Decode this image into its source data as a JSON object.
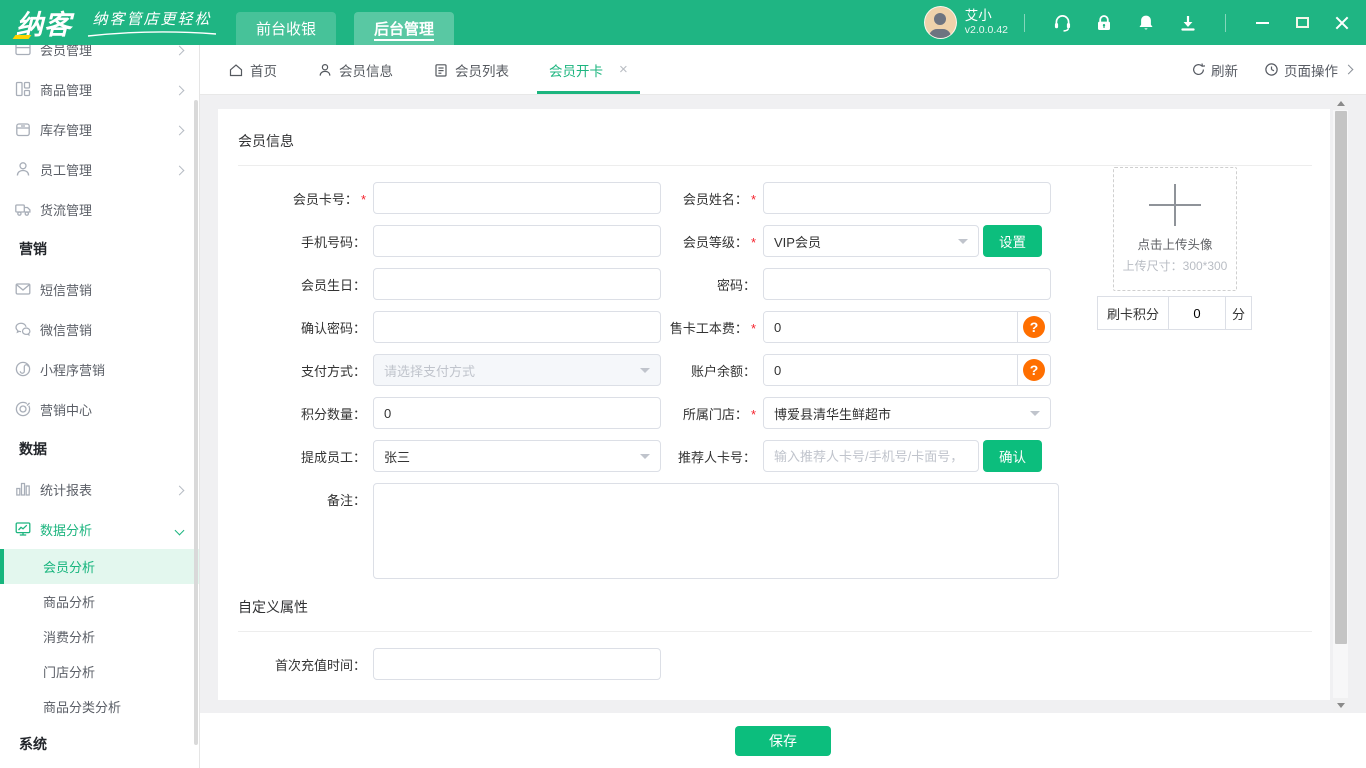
{
  "topbar": {
    "logo": "纳客",
    "tagline": "纳客管店更轻松",
    "nav_front": "前台收银",
    "nav_back": "后台管理",
    "user_name": "艾小",
    "version": "v2.0.0.42"
  },
  "tabbar": {
    "tab_home": "首页",
    "tab_member_info": "会员信息",
    "tab_member_list": "会员列表",
    "tab_member_card": "会员开卡",
    "close": "×",
    "refresh": "刷新",
    "page_ops": "页面操作"
  },
  "sidebar": {
    "item_member": "会员管理",
    "item_goods": "商品管理",
    "item_stock": "库存管理",
    "item_staff": "员工管理",
    "item_logistics": "货流管理",
    "section_marketing": "营销",
    "item_sms": "短信营销",
    "item_wechat": "微信营销",
    "item_miniprogram": "小程序营销",
    "item_marketing_center": "营销中心",
    "section_data": "数据",
    "item_reports": "统计报表",
    "item_analysis": "数据分析",
    "sub_member_analysis": "会员分析",
    "sub_goods_analysis": "商品分析",
    "sub_consume_analysis": "消费分析",
    "sub_store_analysis": "门店分析",
    "sub_category_analysis": "商品分类分析",
    "section_system": "系统"
  },
  "form": {
    "section_member": "会员信息",
    "section_custom": "自定义属性",
    "required_mark": "*",
    "help_mark": "?",
    "card_no": {
      "label": "会员卡号："
    },
    "name": {
      "label": "会员姓名："
    },
    "phone": {
      "label": "手机号码："
    },
    "level": {
      "label": "会员等级：",
      "value": "VIP会员",
      "button": "设置"
    },
    "birthday": {
      "label": "会员生日："
    },
    "password": {
      "label": "密码："
    },
    "confirm_password": {
      "label": "确认密码："
    },
    "card_fee": {
      "label": "售卡工本费：",
      "value": "0"
    },
    "pay_method": {
      "label": "支付方式：",
      "placeholder": "请选择支付方式"
    },
    "balance": {
      "label": "账户余额：",
      "value": "0"
    },
    "points": {
      "label": "积分数量：",
      "value": "0"
    },
    "store": {
      "label": "所属门店：",
      "value": "博爱县清华生鲜超市"
    },
    "staff": {
      "label": "提成员工：",
      "value": "张三"
    },
    "referrer": {
      "label": "推荐人卡号：",
      "placeholder": "输入推荐人卡号/手机号/卡面号，",
      "button": "确认"
    },
    "remark": {
      "label": "备注："
    },
    "first_recharge": {
      "label": "首次充值时间："
    }
  },
  "upload": {
    "text": "点击上传头像",
    "hint": "上传尺寸：300*300"
  },
  "swipe_points": {
    "label": "刷卡积分",
    "value": "0",
    "unit": "分"
  },
  "footer": {
    "save": "保存"
  },
  "colors": {
    "accent_green": "#1fb583",
    "button_green": "#0cbe7d",
    "warn_orange": "#ff6f00",
    "required_red": "#f5222d"
  }
}
